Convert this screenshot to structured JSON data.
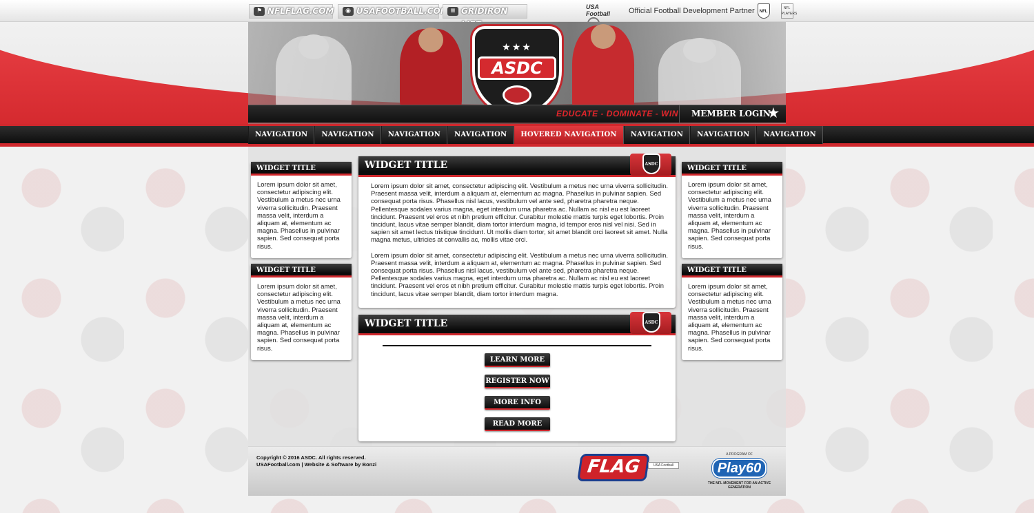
{
  "topbar": {
    "links": [
      "NFLFLAG.COM",
      "USAFOOTBALL.COM",
      "GRIDIRON LIST"
    ],
    "partner_logo": "USA Football",
    "partner_text": "Official Football Development Partner",
    "nfl_label": "NFL",
    "nflp_label": "NFL PLAYERS"
  },
  "banner": {
    "logo_text": "ASDC",
    "logo_stars": "★★★",
    "tagline": "EDUCATE - DOMINATE - WIN",
    "member_login": "MEMBER LOGIN"
  },
  "nav": {
    "items": [
      "NAVIGATION",
      "NAVIGATION",
      "NAVIGATION",
      "NAVIGATION",
      "HOVERED NAVIGATION",
      "NAVIGATION",
      "NAVIGATION",
      "NAVIGATION"
    ],
    "hovered_index": 4
  },
  "widgets": {
    "title": "WIDGET TITLE",
    "side_text": " Lorem ipsum dolor sit amet, consectetur adipiscing elit. Vestibulum a metus nec urna viverra sollicitudin. Praesent massa velit, interdum a aliquam at, elementum ac magna. Phasellus in pulvinar sapien. Sed consequat porta risus.",
    "main_p1": " Lorem ipsum dolor sit amet, consectetur adipiscing elit. Vestibulum a metus nec urna viverra sollicitudin. Praesent massa velit, interdum a aliquam at, elementum ac magna. Phasellus in pulvinar sapien. Sed consequat porta risus. Phasellus nisl lacus, vestibulum vel ante sed, pharetra pharetra neque. Pellentesque sodales varius magna, eget interdum urna pharetra ac. Nullam ac nisl eu est laoreet tincidunt. Praesent vel eros et nibh pretium efficitur. Curabitur molestie mattis turpis eget lobortis. Proin tincidunt, lacus vitae semper blandit, diam tortor interdum magna, id tempor eros nisl vel nisi. Sed in sapien sit amet lectus tristique tincidunt. Ut mollis diam tortor, sit amet blandit orci laoreet sit amet. Nulla magna metus, ultricies at convallis ac, mollis vitae orci.",
    "main_p2": " Lorem ipsum dolor sit amet, consectetur adipiscing elit. Vestibulum a metus nec urna viverra sollicitudin. Praesent massa velit, interdum a aliquam at, elementum ac magna. Phasellus in pulvinar sapien. Sed consequat porta risus. Phasellus nisl lacus, vestibulum vel ante sed, pharetra pharetra neque. Pellentesque sodales varius magna, eget interdum urna pharetra ac. Nullam ac nisl eu est laoreet tincidunt. Praesent vel eros et nibh pretium efficitur. Curabitur molestie mattis turpis eget lobortis. Proin tincidunt, lacus vitae semper blandit, diam tortor interdum magna.",
    "buttons": [
      "LEARN MORE",
      "REGISTER NOW",
      "MORE INFO",
      "READ MORE"
    ]
  },
  "footer": {
    "copyright": "Copyright © 2016 ASDC.  All rights reserved.",
    "credits": "USAFootball.com | Website & Software by Bonzi",
    "flag_logo": "FLAG",
    "play60_program": "A PROGRAM OF",
    "play60_logo": "Play60",
    "play60_motto": "THE NFL MOVEMENT FOR AN ACTIVE GENERATION"
  },
  "colors": {
    "brand_red": "#d0282d",
    "dark": "#111111",
    "white": "#ffffff"
  }
}
